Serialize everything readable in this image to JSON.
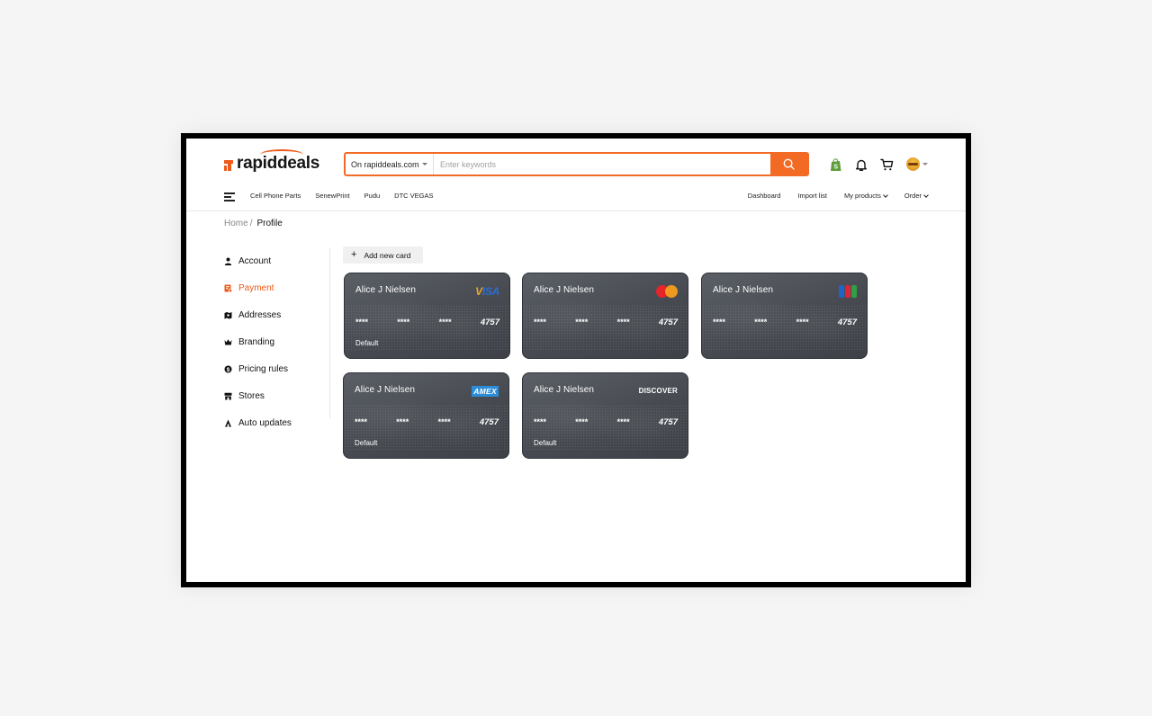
{
  "brand": {
    "logo_text": "rapiddeals"
  },
  "search": {
    "scope": "On rapiddeals.com",
    "placeholder": "Enter keywords",
    "value": ""
  },
  "header_icons": [
    "shopify-icon",
    "bell-icon",
    "cart-icon",
    "avatar"
  ],
  "nav": {
    "left": [
      "Cell Phone Parts",
      "SenewPrint",
      "Pudu",
      "DTC VEGAS"
    ],
    "right": [
      {
        "label": "Dashboard",
        "dropdown": false
      },
      {
        "label": "Import list",
        "dropdown": false
      },
      {
        "label": "My products",
        "dropdown": true
      },
      {
        "label": "Order",
        "dropdown": true
      }
    ]
  },
  "breadcrumb": {
    "home": "Home",
    "separator": "/",
    "current": "Profile"
  },
  "sidebar": {
    "items": [
      {
        "label": "Account",
        "icon": "user-icon",
        "active": false
      },
      {
        "label": "Payment",
        "icon": "payment-icon",
        "active": true
      },
      {
        "label": "Addresses",
        "icon": "address-icon",
        "active": false
      },
      {
        "label": "Branding",
        "icon": "crown-icon",
        "active": false
      },
      {
        "label": "Pricing rules",
        "icon": "dollar-icon",
        "active": false
      },
      {
        "label": "Stores",
        "icon": "store-icon",
        "active": false
      },
      {
        "label": "Auto updates",
        "icon": "auto-update-icon",
        "active": false
      }
    ]
  },
  "main": {
    "add_card_label": "Add new card"
  },
  "cards": [
    {
      "holder": "Alice J Nielsen",
      "brand": "visa",
      "brand_text": "VISA",
      "masked": [
        "****",
        "****",
        "****"
      ],
      "last4": "4757",
      "default_label": "Default"
    },
    {
      "holder": "Alice J Nielsen",
      "brand": "mastercard",
      "brand_text": "",
      "masked": [
        "****",
        "****",
        "****"
      ],
      "last4": "4757",
      "default_label": ""
    },
    {
      "holder": "Alice J Nielsen",
      "brand": "jcb",
      "brand_text": "",
      "masked": [
        "****",
        "****",
        "****"
      ],
      "last4": "4757",
      "default_label": ""
    },
    {
      "holder": "Alice J Nielsen",
      "brand": "amex",
      "brand_text": "AMEX",
      "masked": [
        "****",
        "****",
        "****"
      ],
      "last4": "4757",
      "default_label": "Default"
    },
    {
      "holder": "Alice J Nielsen",
      "brand": "discover",
      "brand_text": "DISCOVER",
      "masked": [
        "****",
        "****",
        "****"
      ],
      "last4": "4757",
      "default_label": "Default"
    }
  ],
  "colors": {
    "accent": "#f26a23",
    "card_bg": "#4a4e54",
    "card_border": "#2e3238"
  }
}
